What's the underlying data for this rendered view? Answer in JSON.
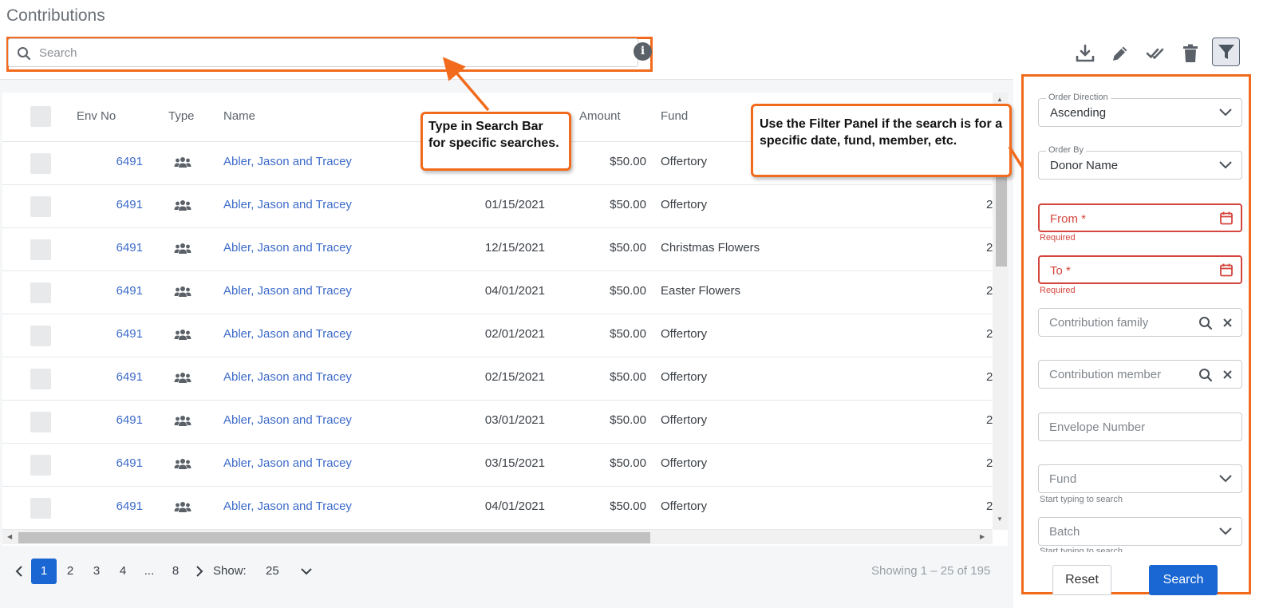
{
  "page": {
    "title": "Contributions"
  },
  "search": {
    "placeholder": "Search"
  },
  "toolbar": {
    "icons": [
      "download-icon",
      "edit-icon",
      "double-check-icon",
      "trash-icon",
      "filter-icon"
    ]
  },
  "table": {
    "columns": [
      "Env No",
      "Type",
      "Name",
      "Amount",
      "Fund"
    ],
    "rows": [
      {
        "env": "6491",
        "type_icon": "family-icon",
        "name": "Abler, Jason and Tracey",
        "date": "",
        "amount": "$50.00",
        "fund": "Offertory",
        "extra": ""
      },
      {
        "env": "6491",
        "type_icon": "family-icon",
        "name": "Abler, Jason and Tracey",
        "date": "01/15/2021",
        "amount": "$50.00",
        "fund": "Offertory",
        "extra": "2"
      },
      {
        "env": "6491",
        "type_icon": "family-icon",
        "name": "Abler, Jason and Tracey",
        "date": "12/15/2021",
        "amount": "$50.00",
        "fund": "Christmas Flowers",
        "extra": "2"
      },
      {
        "env": "6491",
        "type_icon": "family-icon",
        "name": "Abler, Jason and Tracey",
        "date": "04/01/2021",
        "amount": "$50.00",
        "fund": "Easter Flowers",
        "extra": "2"
      },
      {
        "env": "6491",
        "type_icon": "family-icon",
        "name": "Abler, Jason and Tracey",
        "date": "02/01/2021",
        "amount": "$50.00",
        "fund": "Offertory",
        "extra": "2"
      },
      {
        "env": "6491",
        "type_icon": "family-icon",
        "name": "Abler, Jason and Tracey",
        "date": "02/15/2021",
        "amount": "$50.00",
        "fund": "Offertory",
        "extra": "2"
      },
      {
        "env": "6491",
        "type_icon": "family-icon",
        "name": "Abler, Jason and Tracey",
        "date": "03/01/2021",
        "amount": "$50.00",
        "fund": "Offertory",
        "extra": "2"
      },
      {
        "env": "6491",
        "type_icon": "family-icon",
        "name": "Abler, Jason and Tracey",
        "date": "03/15/2021",
        "amount": "$50.00",
        "fund": "Offertory",
        "extra": "2"
      },
      {
        "env": "6491",
        "type_icon": "family-icon",
        "name": "Abler, Jason and Tracey",
        "date": "04/01/2021",
        "amount": "$50.00",
        "fund": "Offertory",
        "extra": "2"
      }
    ]
  },
  "pagination": {
    "pages": [
      "1",
      "2",
      "3",
      "4",
      "...",
      "8"
    ],
    "active_page": "1",
    "show_label": "Show:",
    "page_size": "25",
    "showing_text": "Showing 1 – 25 of 195"
  },
  "callouts": {
    "search": "Type in Search Bar for specific searches.",
    "filter": "Use the Filter Panel if the search is for a specific date, fund, member, etc."
  },
  "filter_panel": {
    "order_direction": {
      "label": "Order Direction",
      "value": "Ascending"
    },
    "order_by": {
      "label": "Order By",
      "value": "Donor Name"
    },
    "from": {
      "placeholder": "From *",
      "hint": "Required"
    },
    "to": {
      "placeholder": "To *",
      "hint": "Required"
    },
    "contribution_family": {
      "placeholder": "Contribution family"
    },
    "contribution_member": {
      "placeholder": "Contribution member"
    },
    "envelope_number": {
      "placeholder": "Envelope Number"
    },
    "fund": {
      "placeholder": "Fund",
      "hint": "Start typing to search"
    },
    "batch": {
      "placeholder": "Batch",
      "hint": "Start typing to search"
    },
    "reset_label": "Reset",
    "search_label": "Search"
  },
  "colors": {
    "accent": "#1a66d2",
    "annotation": "#f26a1b",
    "error": "#d4453d",
    "link": "#3d6bc9"
  }
}
